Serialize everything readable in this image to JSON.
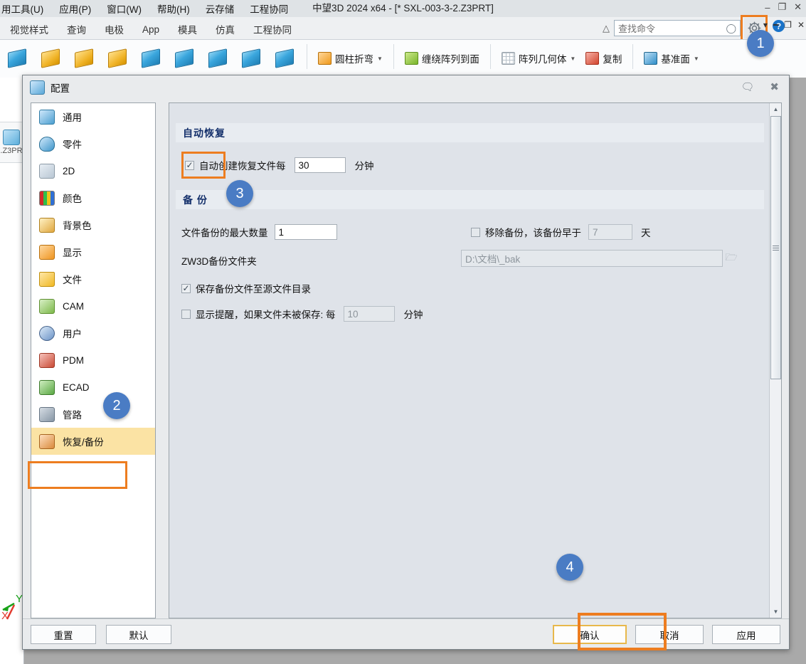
{
  "app": {
    "title": "中望3D 2024 x64 - [* SXL-003-3-2.Z3PRT]",
    "menu": [
      "用工具(U)",
      "应用(P)",
      "窗口(W)",
      "帮助(H)",
      "云存储",
      "工程协同"
    ],
    "ribbon_tabs": [
      "视觉样式",
      "查询",
      "电极",
      "App",
      "模具",
      "仿真",
      "工程协同"
    ],
    "search": {
      "placeholder": "查找命令",
      "icon": "search-icon"
    },
    "home_icon": "home-icon",
    "gear_icon": "gear-icon",
    "help_icon": "help-icon",
    "window_buttons": [
      "minimize",
      "restore",
      "close"
    ],
    "ribbon_commands": [
      {
        "label": "圆柱折弯",
        "icon": "cylinder-bend-icon",
        "has_dropdown": true
      },
      {
        "label": "缠绕阵列到面",
        "icon": "wrap-pattern-icon",
        "has_dropdown": false
      },
      {
        "label": "阵列几何体",
        "icon": "pattern-geometry-icon",
        "has_dropdown": true
      },
      {
        "label": "复制",
        "icon": "copy-icon",
        "has_dropdown": false
      },
      {
        "label": "基准面",
        "icon": "datum-plane-icon",
        "has_dropdown": true
      }
    ],
    "viewport_file_label": ".Z3PR",
    "triad": {
      "y": "Y",
      "x": "X"
    }
  },
  "dialog": {
    "title": "配置",
    "icon": "config-icon",
    "title_buttons": [
      {
        "name": "comment-icon",
        "glyph": "🗩"
      },
      {
        "name": "close-icon",
        "glyph": "✕"
      }
    ],
    "sidebar": {
      "items": [
        {
          "label": "通用",
          "icon": "general-icon",
          "selected": false
        },
        {
          "label": "零件",
          "icon": "part-icon",
          "selected": false
        },
        {
          "label": "2D",
          "icon": "drawing-2d-icon",
          "selected": false
        },
        {
          "label": "颜色",
          "icon": "color-icon",
          "selected": false
        },
        {
          "label": "背景色",
          "icon": "background-icon",
          "selected": false
        },
        {
          "label": "显示",
          "icon": "display-icon",
          "selected": false
        },
        {
          "label": "文件",
          "icon": "file-icon",
          "selected": false
        },
        {
          "label": "CAM",
          "icon": "cam-icon",
          "selected": false
        },
        {
          "label": "用户",
          "icon": "user-icon",
          "selected": false
        },
        {
          "label": "PDM",
          "icon": "pdm-icon",
          "selected": false
        },
        {
          "label": "ECAD",
          "icon": "ecad-icon",
          "selected": false
        },
        {
          "label": "管路",
          "icon": "pipe-icon",
          "selected": false
        },
        {
          "label": "恢复/备份",
          "icon": "backup-icon",
          "selected": true
        }
      ]
    },
    "sections": {
      "autorecover": {
        "title": "自动恢复",
        "auto_create": {
          "label_before": "自动创建恢复文件每",
          "checked": true,
          "value": "30",
          "unit": "分钟"
        }
      },
      "backup": {
        "title": "备 份",
        "max_backups": {
          "label": "文件备份的最大数量",
          "value": "1"
        },
        "remove_older": {
          "label": "移除备份，该备份早于",
          "checked": false,
          "value": "7",
          "unit": "天"
        },
        "folder_label": "ZW3D备份文件夹",
        "folder_path": "D:\\文档\\_bak",
        "browse_icon": "folder-open-icon",
        "save_to_source": {
          "label": "保存备份文件至源文件目录",
          "checked": true
        },
        "remind": {
          "label": "显示提醒，如果文件未被保存: 每",
          "checked": false,
          "value": "10",
          "unit": "分钟"
        }
      }
    },
    "footer": {
      "reset": "重置",
      "default": "默认",
      "ok": "确认",
      "cancel": "取消",
      "apply": "应用"
    }
  },
  "annotations": {
    "badges": [
      "1",
      "2",
      "3",
      "4"
    ],
    "highlight_color": "#ED7D20",
    "badge_color": "#4A7CC4"
  }
}
